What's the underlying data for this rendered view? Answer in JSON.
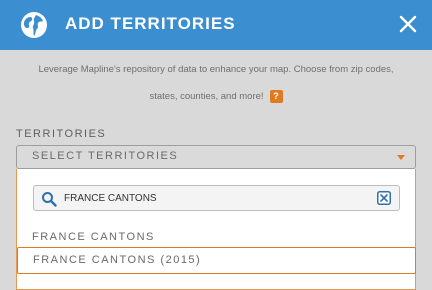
{
  "dialog": {
    "title": "ADD TERRITORIES",
    "description_line1": "Leverage Mapline's repository of data to enhance your map. Choose from zip codes,",
    "description_line2": "states, counties, and more!",
    "help_badge": "?"
  },
  "territories": {
    "label": "TERRITORIES",
    "select_placeholder": "SELECT TERRITORIES"
  },
  "dropdown": {
    "search_value": "FRANCE CANTONS",
    "group_label": "FRANCE CANTONS",
    "option_label": "FRANCE CANTONS (2015)"
  },
  "colors": {
    "header": "#3b8fd1",
    "accent": "#e07a1f"
  },
  "icons": [
    "globe-icon",
    "close-icon",
    "help-icon",
    "chevron-down-icon",
    "search-icon",
    "clear-icon"
  ]
}
